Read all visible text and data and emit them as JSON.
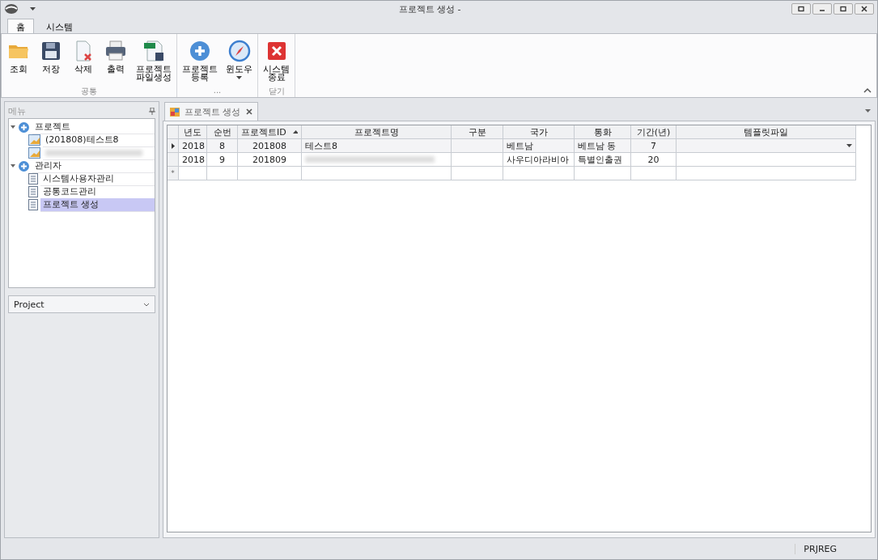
{
  "window": {
    "title": "프로젝트 생성 -"
  },
  "ribbon_tabs": [
    {
      "label": "홈",
      "selected": true
    },
    {
      "label": "시스템",
      "selected": false
    }
  ],
  "ribbon_groups": [
    {
      "label": "공통",
      "buttons": [
        {
          "label": "조회"
        },
        {
          "label": "저장"
        },
        {
          "label": "삭제"
        },
        {
          "label": "출력"
        },
        {
          "label": "프로젝트\n파일생성"
        }
      ]
    },
    {
      "label": "...",
      "buttons": [
        {
          "label": "프로젝트\n등록"
        },
        {
          "label": "윈도우",
          "dropdown": true
        }
      ]
    },
    {
      "label": "닫기",
      "buttons": [
        {
          "label": "시스템\n종료"
        }
      ]
    }
  ],
  "menu_panel": {
    "title": "메뉴",
    "tree": [
      {
        "label": "프로젝트",
        "kind": "group",
        "expanded": true,
        "selected": false,
        "children": [
          {
            "label": "(201808)테스트8",
            "kind": "chart",
            "selected": false
          },
          {
            "kind": "chart",
            "blurred": true,
            "selected": false
          }
        ]
      },
      {
        "label": "관리자",
        "kind": "group",
        "expanded": true,
        "selected": false,
        "children": [
          {
            "label": "시스템사용자관리",
            "kind": "doc",
            "selected": false
          },
          {
            "label": "공통코드관리",
            "kind": "doc",
            "selected": false
          },
          {
            "label": "프로젝트 생성",
            "kind": "doc",
            "selected": true
          }
        ]
      }
    ],
    "combo": {
      "value": "Project"
    }
  },
  "doc_tabs": [
    {
      "label": "프로젝트 생성",
      "selected": true
    }
  ],
  "table": {
    "columns": [
      {
        "label": "년도",
        "sorted": false
      },
      {
        "label": "순번",
        "sorted": false
      },
      {
        "label": "프로젝트ID",
        "sorted": true
      },
      {
        "label": "프로젝트명",
        "sorted": false
      },
      {
        "label": "구분",
        "sorted": false
      },
      {
        "label": "국가",
        "sorted": false
      },
      {
        "label": "통화",
        "sorted": false
      },
      {
        "label": "기간(년)",
        "sorted": false
      },
      {
        "label": "템플릿파일",
        "sorted": false
      }
    ],
    "rows": [
      {
        "current": true,
        "cells": [
          {
            "text": "2018"
          },
          {
            "text": "8"
          },
          {
            "text": "201808"
          },
          {
            "text": "테스트8"
          },
          {},
          {
            "text": "베트남"
          },
          {
            "text": "베트남 동"
          },
          {
            "text": "7"
          },
          {
            "dropdown": true
          }
        ]
      },
      {
        "current": false,
        "cells": [
          {
            "text": "2018"
          },
          {
            "text": "9"
          },
          {
            "text": "201809"
          },
          {
            "blurred": true
          },
          {},
          {
            "text": "사우디아라비아"
          },
          {
            "text": "특별인출권"
          },
          {
            "text": "20"
          },
          {}
        ]
      }
    ],
    "new_row_marker": "*"
  },
  "status_bar": {
    "text": "PRJREG"
  }
}
